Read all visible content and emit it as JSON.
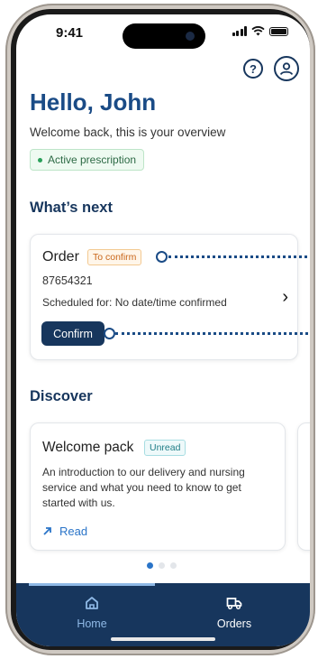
{
  "status_bar": {
    "time": "9:41"
  },
  "header": {
    "help_icon": "help-circle-icon",
    "profile_icon": "user-circle-icon"
  },
  "greeting": {
    "title": "Hello, John",
    "subtitle": "Welcome back, this is your overview",
    "badge": "Active prescription"
  },
  "whats_next": {
    "heading": "What’s next",
    "order": {
      "title": "Order",
      "status": "To confirm",
      "number": "87654321",
      "scheduled": "Scheduled for: No date/time confirmed",
      "confirm_label": "Confirm"
    }
  },
  "discover": {
    "heading": "Discover",
    "cards": [
      {
        "title": "Welcome pack",
        "badge": "Unread",
        "description": "An introduction to our delivery and nursing service and what you need to know to get started with us.",
        "link_label": "Read"
      }
    ],
    "pager": {
      "total": 3,
      "active": 1
    }
  },
  "tabbar": {
    "items": [
      {
        "label": "Home",
        "icon": "home-icon",
        "active": true
      },
      {
        "label": "Orders",
        "icon": "truck-icon",
        "active": false
      }
    ]
  },
  "colors": {
    "primary": "#17365d",
    "heading": "#1a4b86",
    "accent": "#2a74c8",
    "warning": "#c9661a",
    "success": "#2aa05a"
  }
}
